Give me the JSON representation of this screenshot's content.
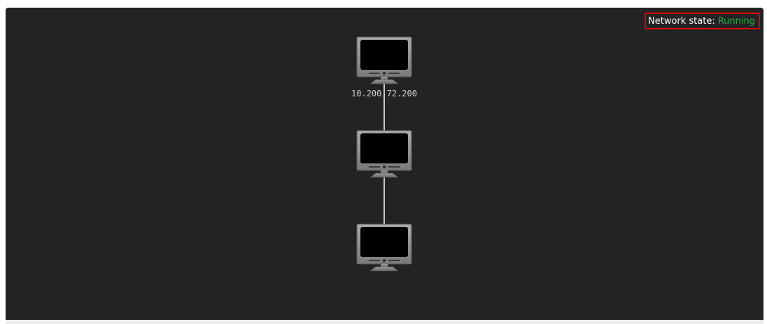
{
  "status": {
    "label": "Network state:",
    "value": "Running",
    "value_color": "#2ea84a",
    "border_color": "#e00000"
  },
  "topology": {
    "nodes": [
      {
        "id": "node-1",
        "icon": "computer-monitor-icon",
        "label": "10.200.72.200"
      },
      {
        "id": "node-2",
        "icon": "computer-monitor-icon",
        "label": ""
      },
      {
        "id": "node-3",
        "icon": "computer-monitor-icon",
        "label": ""
      }
    ],
    "links": [
      {
        "from": "node-1",
        "to": "node-2"
      },
      {
        "from": "node-2",
        "to": "node-3"
      }
    ]
  }
}
